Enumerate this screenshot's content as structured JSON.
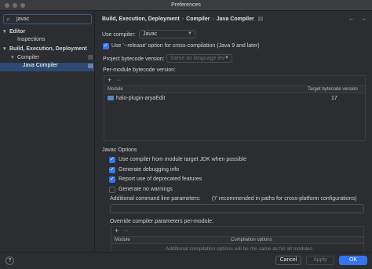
{
  "window": {
    "title": "Preferences"
  },
  "sidebar": {
    "search_value": "javac",
    "items": [
      {
        "label": "Editor",
        "chevron": "▾"
      },
      {
        "label": "Inspections"
      },
      {
        "label": "Build, Execution, Deployment",
        "chevron": "▾"
      },
      {
        "label": "Compiler",
        "chevron": "▾"
      },
      {
        "label": "Java Compiler"
      }
    ]
  },
  "breadcrumb": {
    "parts": [
      "Build, Execution, Deployment",
      "Compiler",
      "Java Compiler"
    ],
    "separator": "›"
  },
  "compiler": {
    "use_compiler_label": "Use compiler:",
    "use_compiler_value": "Javac",
    "release_option_label": "Use '--release' option for cross-compilation (Java 9 and later)",
    "release_option_checked": true,
    "bytecode_label": "Project bytecode version:",
    "bytecode_value": "Same as language lev",
    "per_module_label": "Per-module bytecode version:",
    "modules_table": {
      "col_module": "Module",
      "col_target": "Target bytecode version",
      "rows": [
        {
          "module": "halo-plugin-aryaEdit",
          "target": "17"
        }
      ]
    }
  },
  "javac": {
    "section_title": "Javac Options",
    "options": [
      {
        "label": "Use compiler from module target JDK when possible",
        "checked": true
      },
      {
        "label": "Generate debugging info",
        "checked": true
      },
      {
        "label": "Report use of deprecated features",
        "checked": true
      },
      {
        "label": "Generate no warnings",
        "checked": false
      }
    ],
    "additional_label": "Additional command line parameters:",
    "additional_hint": "('/' recommended in paths for cross-platform configurations)",
    "override_label": "Override compiler parameters per-module:",
    "override_table": {
      "col_module": "Module",
      "col_options": "Compilation options",
      "empty_text": "Additional compilation options will be the same as for all modules"
    }
  },
  "footer": {
    "help": "?",
    "cancel": "Cancel",
    "apply": "Apply",
    "ok": "OK"
  },
  "colors": {
    "accent": "#3574f0",
    "selection": "#2e4a73",
    "background": "#2b2d30"
  }
}
